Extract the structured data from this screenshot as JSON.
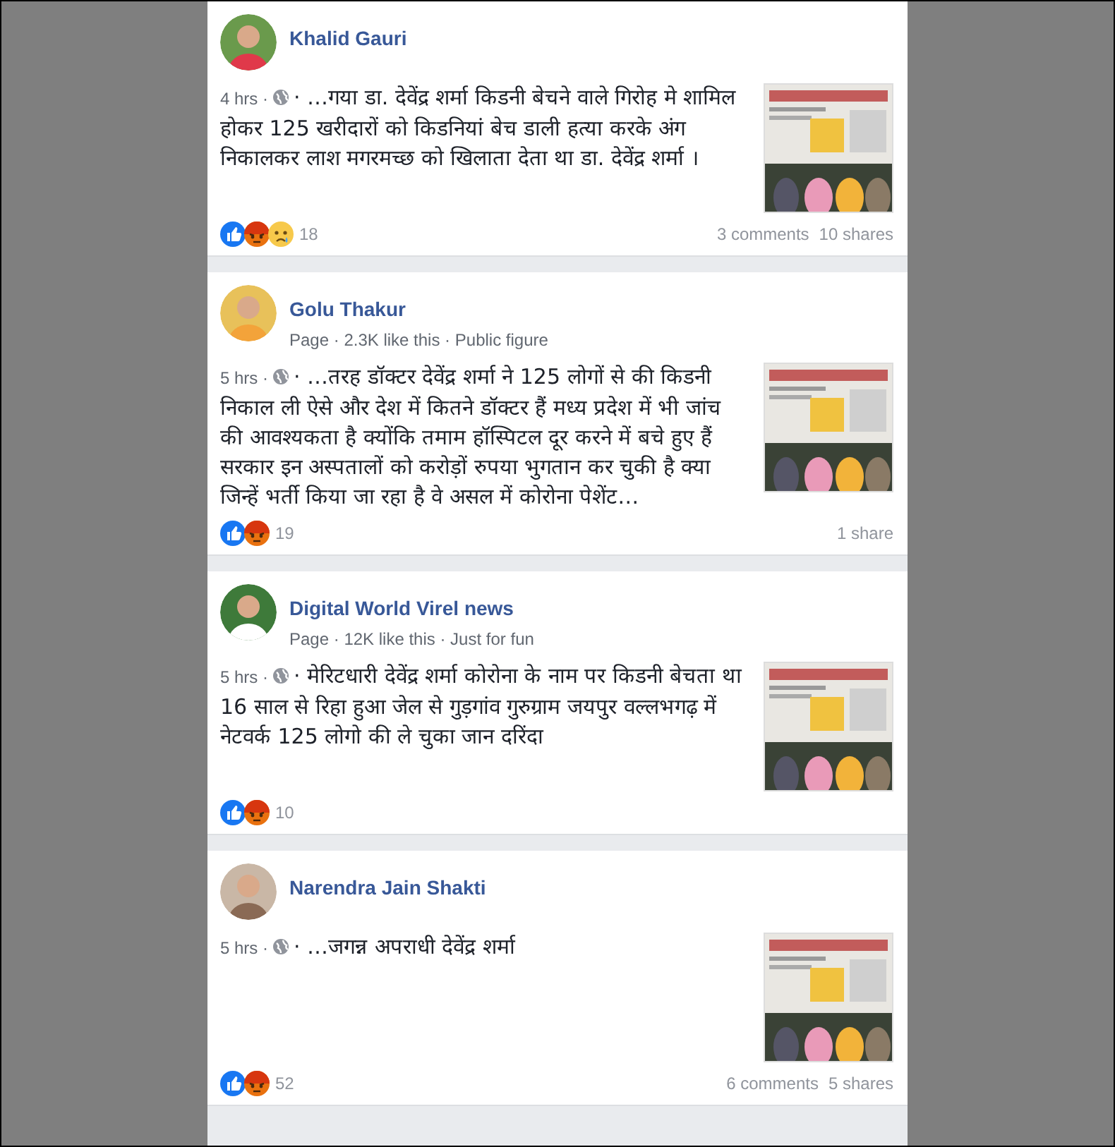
{
  "posts": [
    {
      "author": "Khalid Gauri",
      "time": "4 hrs ·",
      "text": "· …गया डा. देवेंद्र शर्मा किडनी बेचने वाले गिरोह मे शामिल होकर 125 खरीदारों को किडनियां बेच डाली हत्या करके अंग निकालकर लाश मगरमच्छ को खिलाता देता था डा. देवेंद्र शर्मा ।",
      "reactions": [
        {
          "kind": "like"
        },
        {
          "kind": "angry"
        },
        {
          "kind": "sad"
        }
      ],
      "count": "18",
      "stats": [
        "3 comments",
        "10 shares"
      ]
    },
    {
      "author": "Golu Thakur",
      "meta": "Page · 2.3K like this · Public figure",
      "time": "5 hrs ·",
      "text": "· …तरह डॉक्टर देवेंद्र शर्मा ने 125 लोगों से की किडनी निकाल ली ऐसे और देश में कितने डॉक्टर हैं मध्य प्रदेश में भी जांच की आवश्यकता है क्योंकि तमाम हॉस्पिटल दूर करने में बचे हुए हैं सरकार इन अस्पतालों को करोड़ों रुपया भुगतान कर चुकी है क्या जिन्हें भर्ती किया जा रहा है वे असल में कोरोना पेशेंट…",
      "reactions": [
        {
          "kind": "like"
        },
        {
          "kind": "angry"
        }
      ],
      "count": "19",
      "stats": [
        "1 share"
      ]
    },
    {
      "author": "Digital World Virel news",
      "meta": "Page · 12K like this · Just for fun",
      "time": "5 hrs ·",
      "text": "· मेरिटधारी देवेंद्र शर्मा कोरोना के नाम पर किडनी बेचता था 16 साल से रिहा हुआ जेल से गुड़गांव गुरुग्राम जयपुर वल्लभगढ़ में नेटवर्क 125 लोगो की ले चुका जान दरिंदा",
      "reactions": [
        {
          "kind": "like"
        },
        {
          "kind": "angry"
        }
      ],
      "count": "10"
    },
    {
      "author": "Narendra Jain Shakti",
      "time": "5 hrs ·",
      "text": "· …जगन्न अपराधी देवेंद्र शर्मा",
      "reactions": [
        {
          "kind": "like"
        },
        {
          "kind": "angry"
        }
      ],
      "count": "52",
      "stats": [
        "6 comments",
        "5 shares"
      ]
    }
  ]
}
